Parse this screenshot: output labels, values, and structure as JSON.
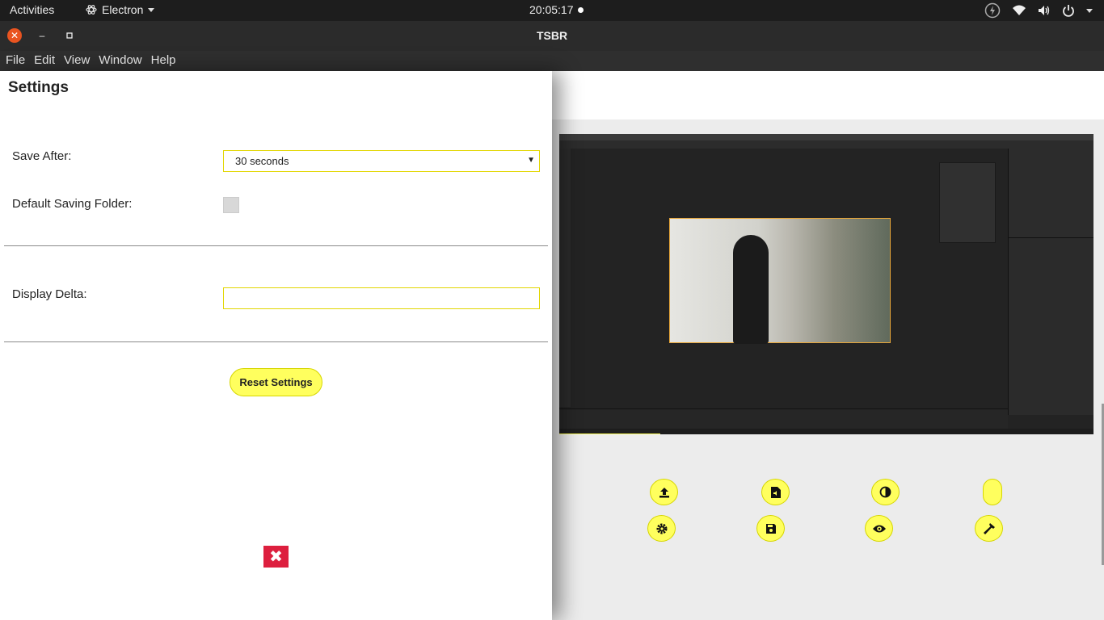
{
  "topbar": {
    "activities": "Activities",
    "app_name": "Electron",
    "clock": "20:05:17"
  },
  "window": {
    "title": "TSBR"
  },
  "menu": {
    "items": [
      "File",
      "Edit",
      "View",
      "Window",
      "Help"
    ]
  },
  "settings": {
    "heading": "Settings",
    "save_after_label": "Save After:",
    "save_after_value": "30 seconds",
    "default_folder_label": "Default Saving Folder:",
    "display_delta_label": "Display Delta:",
    "display_delta_value": "",
    "reset_label": "Reset Settings",
    "close_icon": "✖"
  },
  "toolbar_icons": [
    "upload-icon",
    "file-audio-icon",
    "contrast-icon",
    "blank-pill-icon",
    "gear-icon",
    "save-icon",
    "eye-icon",
    "hammer-icon"
  ],
  "colors": {
    "accent_yellow": "#ffff5e",
    "close_red": "#dd1f3e",
    "ubuntu_orange": "#e95420"
  }
}
